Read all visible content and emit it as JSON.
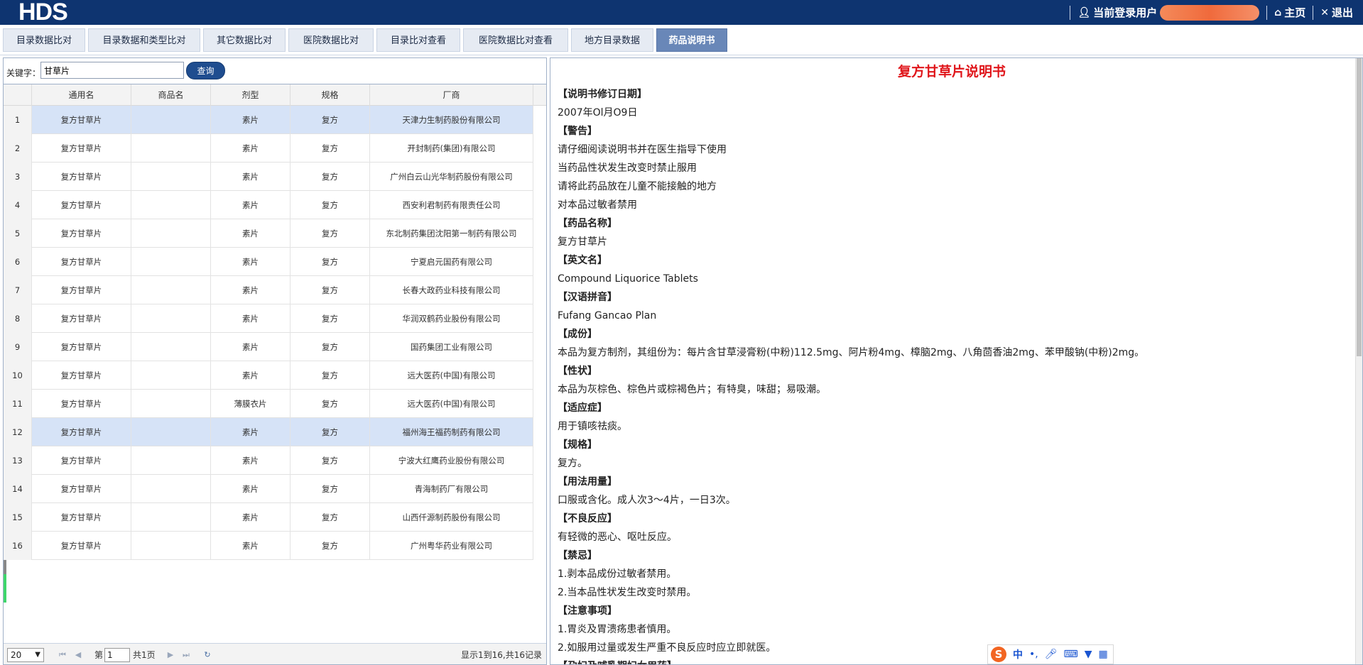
{
  "header": {
    "logo": "HDS",
    "user_label": "当前登录用户",
    "home_label": "主页",
    "logout_label": "退出"
  },
  "tabs": [
    {
      "label": "目录数据比对"
    },
    {
      "label": "目录数据和类型比对"
    },
    {
      "label": "其它数据比对"
    },
    {
      "label": "医院数据比对"
    },
    {
      "label": "目录比对查看"
    },
    {
      "label": "医院数据比对查看"
    },
    {
      "label": "地方目录数据"
    },
    {
      "label": "药品说明书",
      "active": true
    }
  ],
  "search": {
    "label": "关键字：",
    "value": "甘草片",
    "button": "查询"
  },
  "grid": {
    "columns": [
      "通用名",
      "商品名",
      "剂型",
      "规格",
      "厂商"
    ],
    "rows": [
      {
        "n": "1",
        "name": "复方甘草片",
        "trade": "",
        "form": "素片",
        "spec": "复方",
        "maker": "天津力生制药股份有限公司",
        "selected": true
      },
      {
        "n": "2",
        "name": "复方甘草片",
        "trade": "",
        "form": "素片",
        "spec": "复方",
        "maker": "开封制药(集团)有限公司"
      },
      {
        "n": "3",
        "name": "复方甘草片",
        "trade": "",
        "form": "素片",
        "spec": "复方",
        "maker": "广州白云山光华制药股份有限公司"
      },
      {
        "n": "4",
        "name": "复方甘草片",
        "trade": "",
        "form": "素片",
        "spec": "复方",
        "maker": "西安利君制药有限责任公司"
      },
      {
        "n": "5",
        "name": "复方甘草片",
        "trade": "",
        "form": "素片",
        "spec": "复方",
        "maker": "东北制药集团沈阳第一制药有限公司"
      },
      {
        "n": "6",
        "name": "复方甘草片",
        "trade": "",
        "form": "素片",
        "spec": "复方",
        "maker": "宁夏启元国药有限公司"
      },
      {
        "n": "7",
        "name": "复方甘草片",
        "trade": "",
        "form": "素片",
        "spec": "复方",
        "maker": "长春大政药业科技有限公司"
      },
      {
        "n": "8",
        "name": "复方甘草片",
        "trade": "",
        "form": "素片",
        "spec": "复方",
        "maker": "华润双鹤药业股份有限公司"
      },
      {
        "n": "9",
        "name": "复方甘草片",
        "trade": "",
        "form": "素片",
        "spec": "复方",
        "maker": "国药集团工业有限公司"
      },
      {
        "n": "10",
        "name": "复方甘草片",
        "trade": "",
        "form": "素片",
        "spec": "复方",
        "maker": "远大医药(中国)有限公司"
      },
      {
        "n": "11",
        "name": "复方甘草片",
        "trade": "",
        "form": "薄膜衣片",
        "spec": "复方",
        "maker": "远大医药(中国)有限公司"
      },
      {
        "n": "12",
        "name": "复方甘草片",
        "trade": "",
        "form": "素片",
        "spec": "复方",
        "maker": "福州海王福药制药有限公司",
        "selected": true
      },
      {
        "n": "13",
        "name": "复方甘草片",
        "trade": "",
        "form": "素片",
        "spec": "复方",
        "maker": "宁波大红鹰药业股份有限公司"
      },
      {
        "n": "14",
        "name": "复方甘草片",
        "trade": "",
        "form": "素片",
        "spec": "复方",
        "maker": "青海制药厂有限公司"
      },
      {
        "n": "15",
        "name": "复方甘草片",
        "trade": "",
        "form": "素片",
        "spec": "复方",
        "maker": "山西仟源制药股份有限公司"
      },
      {
        "n": "16",
        "name": "复方甘草片",
        "trade": "",
        "form": "素片",
        "spec": "复方",
        "maker": "广州粤华药业有限公司"
      }
    ]
  },
  "pager": {
    "page_size": "20",
    "page_prefix": "第",
    "page_value": "1",
    "page_suffix": "共1页",
    "info": "显示1到16,共16记录"
  },
  "document": {
    "title": "复方甘草片说明书",
    "lines": [
      {
        "text": "【说明书修订日期】",
        "h": true
      },
      {
        "text": "2007年Ol月O9日"
      },
      {
        "text": "【警告】",
        "h": true
      },
      {
        "text": "请仔细阅读说明书并在医生指导下使用"
      },
      {
        "text": "当药品性状发生改变时禁止服用"
      },
      {
        "text": "请将此药品放在儿童不能接触的地方"
      },
      {
        "text": "对本品过敏者禁用"
      },
      {
        "text": "【药品名称】",
        "h": true
      },
      {
        "text": "复方甘草片"
      },
      {
        "text": "【英文名】",
        "h": true
      },
      {
        "text": "Compound Liquorice Tablets"
      },
      {
        "text": "【汉语拼音】",
        "h": true
      },
      {
        "text": "Fufang Gancao Plan"
      },
      {
        "text": "【成份】",
        "h": true
      },
      {
        "text": "本品为复方制剂，其组份为：每片含甘草浸膏粉(中粉)112.5mg、阿片粉4mg、樟脑2mg、八角茴香油2mg、苯甲酸钠(中粉)2mg。"
      },
      {
        "text": "【性状】",
        "h": true
      },
      {
        "text": "本品为灰棕色、棕色片或棕褐色片；有特臭，味甜；易吸潮。"
      },
      {
        "text": "【适应症】",
        "h": true
      },
      {
        "text": "用于镇咳祛痰。"
      },
      {
        "text": "【规格】",
        "h": true
      },
      {
        "text": "复方。"
      },
      {
        "text": "【用法用量】",
        "h": true
      },
      {
        "text": "口服或含化。成人次3～4片，一日3次。"
      },
      {
        "text": "【不良反应】",
        "h": true
      },
      {
        "text": "有轻微的恶心、呕吐反应。"
      },
      {
        "text": "【禁忌】",
        "h": true
      },
      {
        "text": "1.剥本品成份过敏者禁用。"
      },
      {
        "text": "2.当本品性状发生改变时禁用。"
      },
      {
        "text": "【注意事项】",
        "h": true
      },
      {
        "text": "1.胃炎及胃溃疡患者慎用。"
      },
      {
        "text": "2.如服用过量或发生严重不良反应时应立即就医。"
      },
      {
        "text": "【孕妇及哺乳期妇女用药】",
        "h": true
      }
    ]
  },
  "ime": {
    "logo": "S",
    "mode": "中"
  },
  "colors": {
    "header_bg": "#0e3470",
    "active_tab": "#6987b8",
    "title_red": "#e0161b",
    "selected_row": "#d6e3f7"
  }
}
